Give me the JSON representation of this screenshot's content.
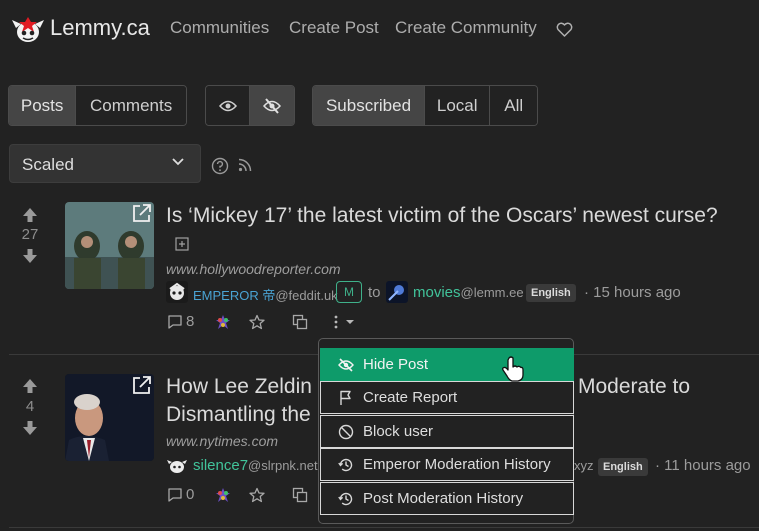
{
  "header": {
    "site_name": "Lemmy.ca",
    "nav": [
      "Communities",
      "Create Post",
      "Create Community"
    ],
    "icons": [
      "lemmy-logo",
      "heart-icon"
    ]
  },
  "filters": {
    "type_tabs": [
      "Posts",
      "Comments"
    ],
    "listing_tabs": [
      "Subscribed",
      "Local",
      "All"
    ],
    "sort_value": "Scaled"
  },
  "posts": [
    {
      "score": "27",
      "title": "Is ‘Mickey 17’ the latest victim of the Oscars’ newest curse?",
      "domain": "www.hollywoodreporter.com",
      "author_name": "EMPEROR 帝",
      "author_instance": "@feddit.uk",
      "mod_badge": "M",
      "to_text": "to",
      "community_name": "movies",
      "community_instance": "@lemm.ee",
      "language": "English",
      "time": "· 15 hours ago",
      "comments": "8"
    },
    {
      "score": "4",
      "title_left": "How Lee Zeldin",
      "title_right": "Moderate to",
      "title_line2": "Dismantling the",
      "domain": "www.nytimes.com",
      "author_name": "silence7",
      "author_instance": "@slrpnk.net",
      "community_fragment": "xyz",
      "language": "English",
      "time": "· 11 hours ago",
      "comments": "0"
    }
  ],
  "dropdown": {
    "items": [
      "Hide Post",
      "Create Report",
      "Block user",
      "Emperor Moderation History",
      "Post Moderation History"
    ],
    "highlight_color": "#0e9b6a"
  },
  "colors": {
    "background": "#222222",
    "accent": "#41c39a",
    "user": "#4aa3d3"
  }
}
